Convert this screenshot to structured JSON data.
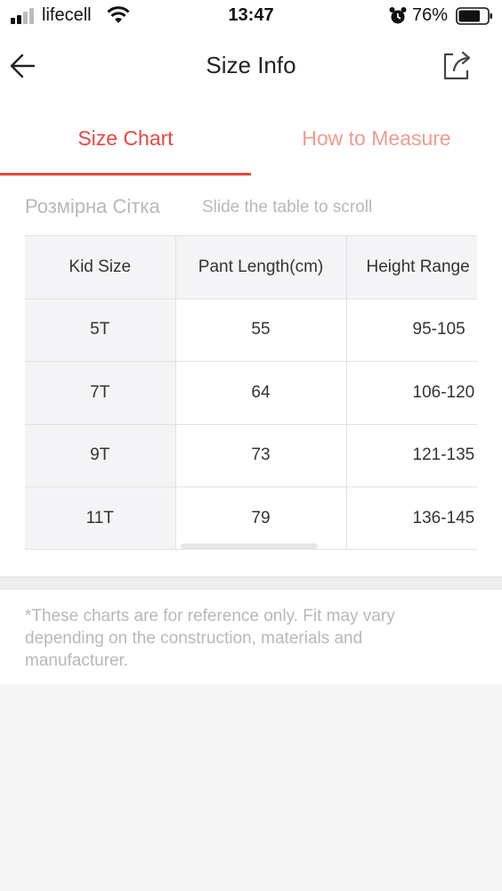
{
  "status_bar": {
    "carrier": "lifecell",
    "time": "13:47",
    "battery_percent": "76%",
    "battery_level": 0.76,
    "icons": [
      "signal-icon",
      "wifi-icon",
      "alarm-icon",
      "battery-icon"
    ]
  },
  "header": {
    "title": "Size Info",
    "back_icon": "back-arrow-icon",
    "share_icon": "share-icon"
  },
  "tabs": [
    {
      "label": "Size Chart",
      "active": true
    },
    {
      "label": "How to Measure",
      "active": false
    }
  ],
  "section": {
    "title": "Розмірна Сітка",
    "hint": "Slide the table to scroll"
  },
  "size_table": {
    "columns": [
      "Kid Size",
      "Pant Length(cm)",
      "Height Range"
    ],
    "rows": [
      [
        "5T",
        "55",
        "95-105"
      ],
      [
        "7T",
        "64",
        "106-120"
      ],
      [
        "9T",
        "73",
        "121-135"
      ],
      [
        "11T",
        "79",
        "136-145"
      ]
    ]
  },
  "note": {
    "text": "*These charts are for reference only. Fit may vary depending on the construction, materials and manufacturer."
  },
  "colors": {
    "accent": "#e8473f",
    "accent_light": "#f19a8f",
    "muted_text": "#b8b8b8",
    "table_header_bg": "#f4f4f6"
  }
}
